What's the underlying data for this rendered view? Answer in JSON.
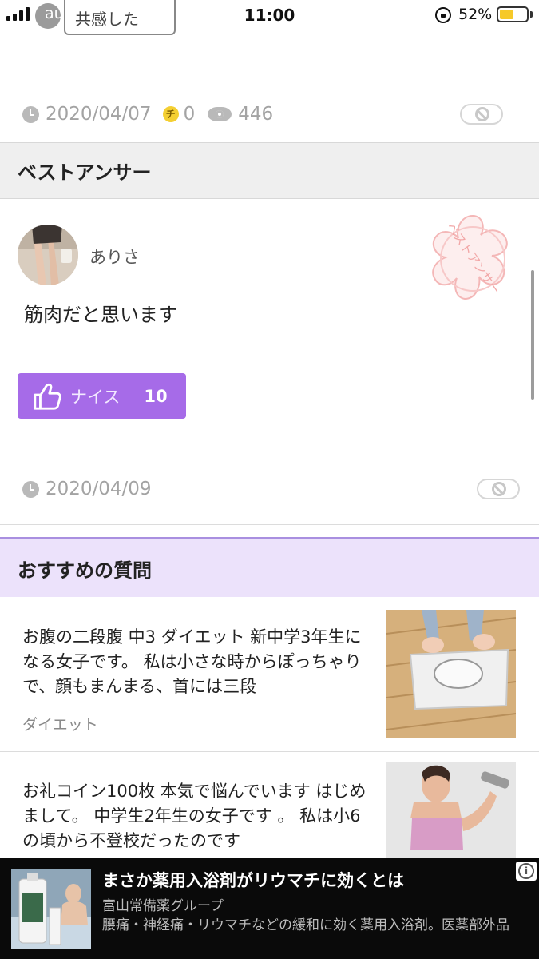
{
  "status_bar": {
    "carrier": "au",
    "reaction_label": "共感した",
    "time": "11:00",
    "battery_percent": "52%",
    "battery_level": 0.52
  },
  "question_meta": {
    "date": "2020/04/07",
    "coin_icon_label": "チ",
    "coins": "0",
    "views": "446"
  },
  "best_answer": {
    "section_title": "ベストアンサー",
    "stamp_text": "ベストアンサー",
    "username": "ありさ",
    "text": "筋肉だと思います",
    "nice_label": "ナイス",
    "nice_count": "10",
    "date": "2020/04/09"
  },
  "recommended": {
    "section_title": "おすすめの質問",
    "items": [
      {
        "text": "お腹の二段腹 中3 ダイエット  新中学3年生になる女子です。 私は小さな時からぽっちゃりで、顔もまんまる、首には三段",
        "category": "ダイエット",
        "image": "bathroom-scale-photo"
      },
      {
        "text": "お礼コイン100枚  本気で悩んでいます はじめまして。 中学生2年生の女子です 。 私は小6の頃から不登校だったのです",
        "category": "",
        "image": "woman-dumbbell-photo"
      }
    ]
  },
  "ad": {
    "title": "まさか薬用入浴剤がリウマチに効くとは",
    "advertiser": "富山常備薬グループ",
    "description": "腰痛・神経痛・リウマチなどの緩和に効く薬用入浴剤。医薬部外品",
    "image_label": "医薬部外品"
  }
}
